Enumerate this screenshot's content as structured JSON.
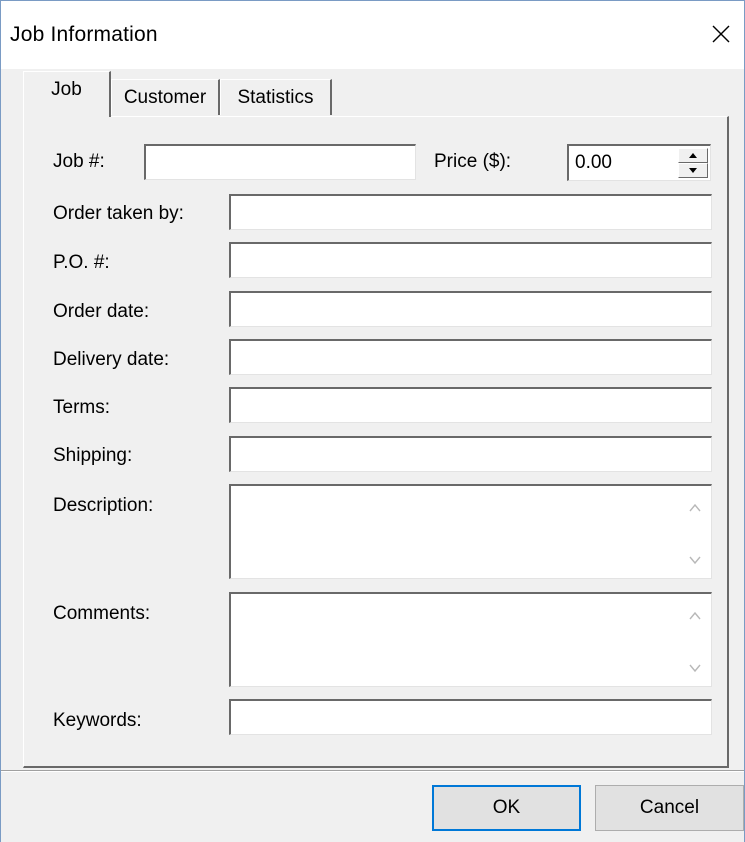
{
  "window": {
    "title": "Job Information",
    "close_icon": "close-icon"
  },
  "tabs": [
    {
      "label": "Job",
      "active": true
    },
    {
      "label": "Customer",
      "active": false
    },
    {
      "label": "Statistics",
      "active": false
    }
  ],
  "form": {
    "job_number": {
      "label": "Job #:",
      "value": ""
    },
    "price": {
      "label": "Price ($):",
      "value": "0.00"
    },
    "order_taken_by": {
      "label": "Order taken by:",
      "value": ""
    },
    "po_number": {
      "label": "P.O. #:",
      "value": ""
    },
    "order_date": {
      "label": "Order date:",
      "value": ""
    },
    "delivery_date": {
      "label": "Delivery date:",
      "value": ""
    },
    "terms": {
      "label": "Terms:",
      "value": ""
    },
    "shipping": {
      "label": "Shipping:",
      "value": ""
    },
    "description": {
      "label": "Description:",
      "value": ""
    },
    "comments": {
      "label": "Comments:",
      "value": ""
    },
    "keywords": {
      "label": "Keywords:",
      "value": ""
    }
  },
  "buttons": {
    "ok": "OK",
    "cancel": "Cancel"
  },
  "colors": {
    "dialog_bg": "#f0f0f0",
    "focus_border": "#0078d7",
    "shadow": "#696969"
  }
}
